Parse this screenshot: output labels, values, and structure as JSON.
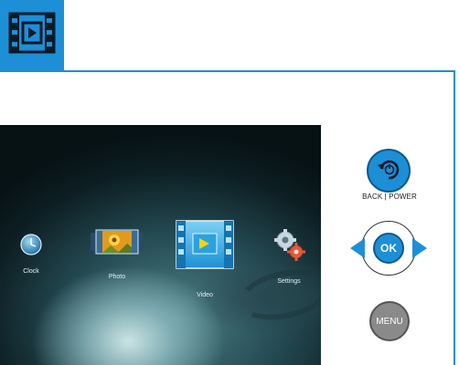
{
  "header": {
    "icon": "film-play-icon",
    "accent": "#1d8fd6"
  },
  "screen": {
    "menu_items": [
      {
        "label": "Clock",
        "icon": "clock-icon"
      },
      {
        "label": "Photo",
        "icon": "photo-filmstrip-icon"
      },
      {
        "label": "Video",
        "icon": "video-icon",
        "selected": true
      },
      {
        "label": "Settings",
        "icon": "gears-icon"
      }
    ]
  },
  "remote": {
    "back_label": "BACK | POWER",
    "ok_label": "OK",
    "menu_label": "MENU",
    "button_color": "#1d8fd6",
    "menu_button_color": "#8a8a8a"
  }
}
